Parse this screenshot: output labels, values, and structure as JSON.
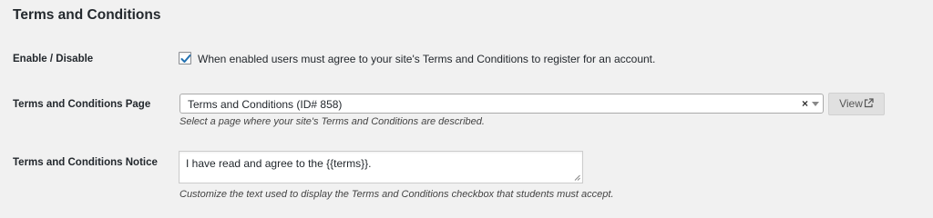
{
  "section": {
    "title": "Terms and Conditions"
  },
  "enable_row": {
    "label": "Enable / Disable",
    "checked": true,
    "checkbox_text": "When enabled users must agree to your site's Terms and Conditions to register for an account."
  },
  "page_row": {
    "label": "Terms and Conditions Page",
    "selected_value": "Terms and Conditions (ID# 858)",
    "clear_glyph": "×",
    "view_label": "View",
    "description": "Select a page where your site's Terms and Conditions are described."
  },
  "notice_row": {
    "label": "Terms and Conditions Notice",
    "value": "I have read and agree to the {{terms}}.",
    "description": "Customize the text used to display the Terms and Conditions checkbox that students must accept."
  },
  "colors": {
    "checkmark": "#2271b1",
    "background": "#f1f1f1"
  },
  "icons": {
    "checkbox_mark": "checkmark-icon",
    "view_external": "external-link-icon",
    "select_arrow": "chevron-down-icon",
    "resize": "resize-handle-icon"
  }
}
